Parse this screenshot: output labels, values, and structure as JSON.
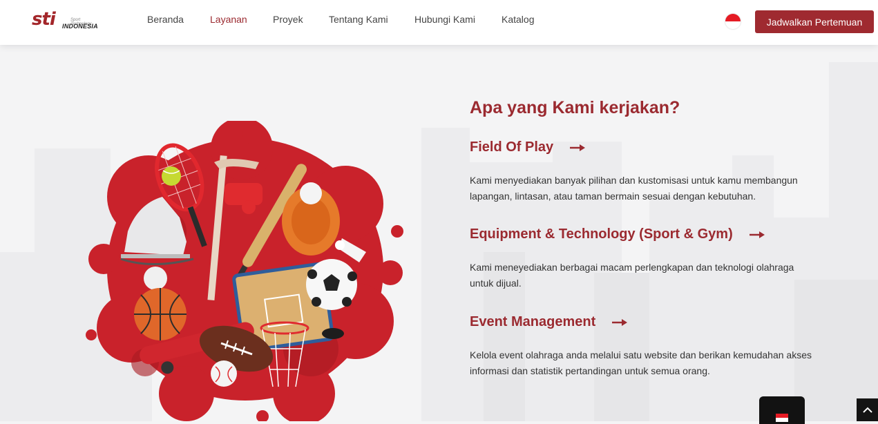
{
  "brand": {
    "logo_main": "sti",
    "logo_sub": "INDONESIA",
    "logo_tag": "Sport Technology"
  },
  "nav": {
    "items": [
      {
        "label": "Beranda",
        "active": false
      },
      {
        "label": "Layanan",
        "active": true
      },
      {
        "label": "Proyek",
        "active": false
      },
      {
        "label": "Tentang Kami",
        "active": false
      },
      {
        "label": "Hubungi Kami",
        "active": false
      },
      {
        "label": "Katalog",
        "active": false
      }
    ],
    "language_flag": "indonesia-flag-icon",
    "cta_label": "Jadwalkan Pertemuan"
  },
  "main": {
    "section_title": "Apa yang Kami kerjakan?",
    "services": [
      {
        "title": "Field Of Play",
        "description": "Kami menyediakan banyak pilihan dan kustomisasi untuk kamu membangun lapangan, lintasan, atau taman bermain sesuai dengan kebutuhan."
      },
      {
        "title": "Equipment & Technology (Sport & Gym)",
        "description": "Kami meneyediakan berbagai macam perlengkapan dan teknologi olahraga untuk dijual."
      },
      {
        "title": "Event Management",
        "description": "Kelola event olahraga anda melalui satu website dan berikan kemudahan akses informasi dan statistik pertandingan untuk semua orang."
      }
    ]
  },
  "colors": {
    "brand_red": "#9b2a30",
    "button_red": "#9f2a30",
    "text_gray": "#444444",
    "background": "#f4f4f5"
  },
  "icons": {
    "arrow": "arrow-right-icon",
    "scroll_top": "chevron-up-icon",
    "language_widget": "indonesia-flag-icon"
  }
}
